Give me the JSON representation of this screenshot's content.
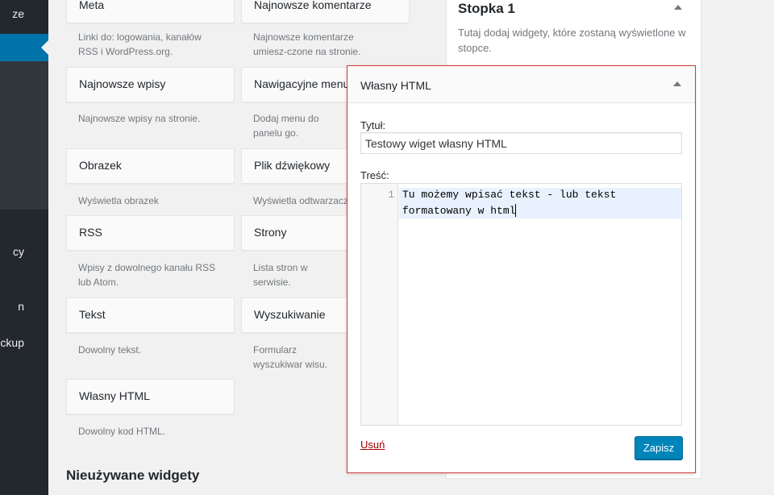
{
  "admin_menu": {
    "labels": [
      "ze",
      "cy",
      "n",
      "ckup"
    ]
  },
  "available_widgets": [
    {
      "title": "Meta",
      "desc": "Linki do: logowania, kanałów RSS i WordPress.org."
    },
    {
      "title": "Najnowsze komentarze",
      "desc": "Najnowsze komentarze umiesz-czone na stronie."
    },
    {
      "title": "Najnowsze wpisy",
      "desc": "Najnowsze wpisy na stronie."
    },
    {
      "title": "Nawigacyjne menu",
      "desc": "Dodaj menu do panelu go."
    },
    {
      "title": "Obrazek",
      "desc": "Wyświetla obrazek"
    },
    {
      "title": "Plik dźwiękowy",
      "desc": "Wyświetla odtwarzacz"
    },
    {
      "title": "RSS",
      "desc": "Wpisy z dowolnego kanału RSS lub Atom."
    },
    {
      "title": "Strony",
      "desc": "Lista stron w serwisie."
    },
    {
      "title": "Tekst",
      "desc": "Dowolny tekst."
    },
    {
      "title": "Wyszukiwanie",
      "desc": "Formularz wyszukiwar wisu."
    },
    {
      "title": "Własny HTML",
      "desc": "Dowolny kod HTML."
    }
  ],
  "unused_section_title": "Nieużywane widgety",
  "sidebar_area": {
    "title": "Stopka 1",
    "description": "Tutaj dodaj widgety, które zostaną wyświetlone w stopce."
  },
  "open_widget": {
    "header_title": "Własny HTML",
    "title_label": "Tytuł:",
    "title_value": "Testowy wiget własny HTML",
    "content_label": "Treść:",
    "line_number": "1",
    "code": "Tu możemy wpisać tekst - lub tekst formatowany w html",
    "delete_label": "Usuń",
    "save_label": "Zapisz"
  },
  "colors": {
    "accent": "#0085ba",
    "active_menu": "#0073aa",
    "highlight_border": "#d63638",
    "delete_link": "#a00000"
  }
}
